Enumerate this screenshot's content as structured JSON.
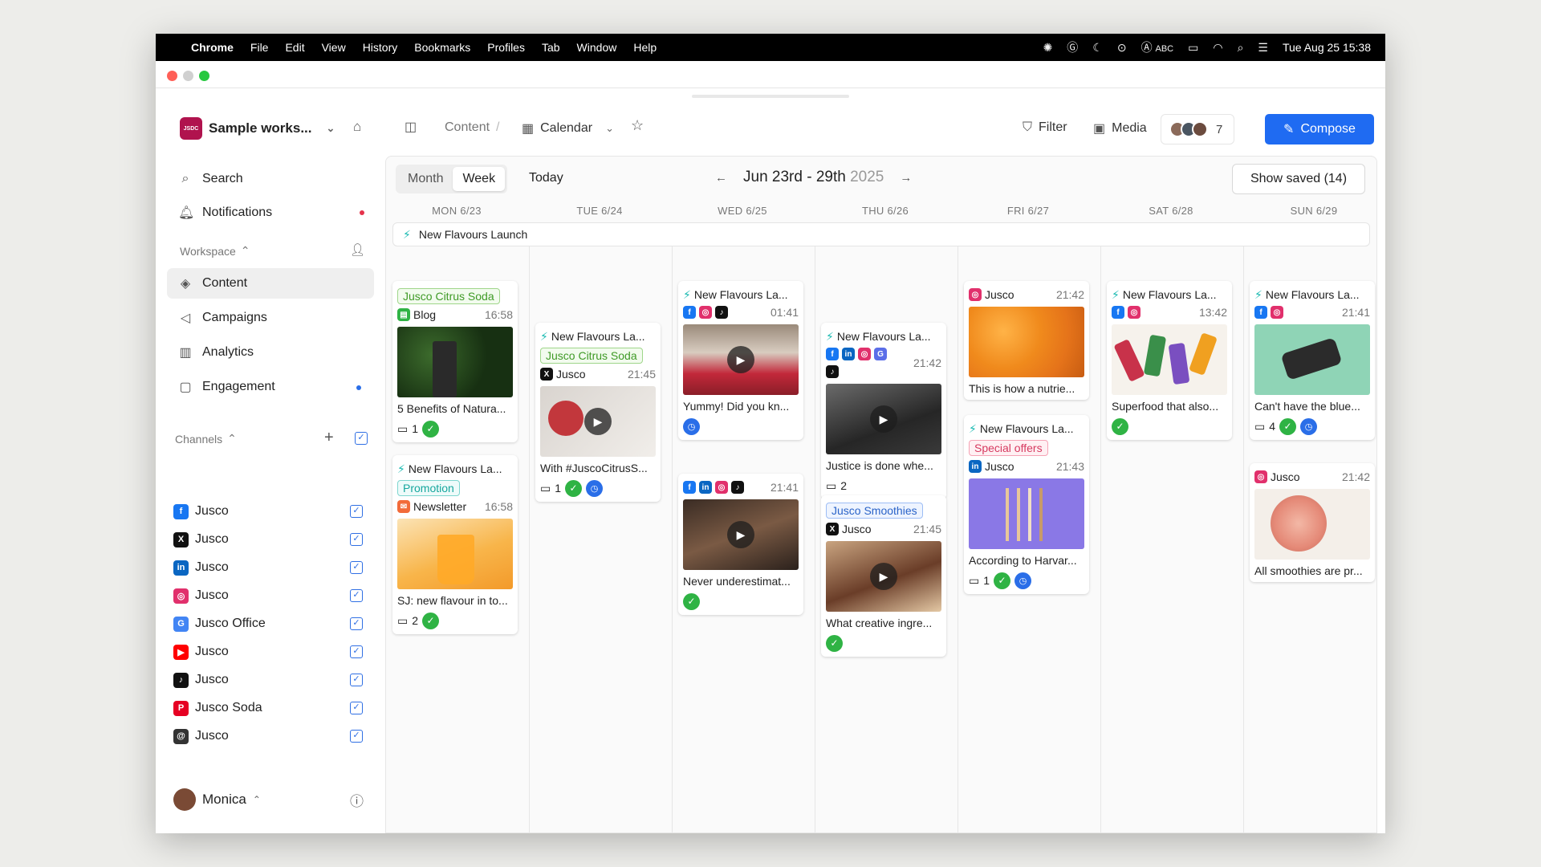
{
  "menubar": {
    "app": "Chrome",
    "items": [
      "File",
      "Edit",
      "View",
      "History",
      "Bookmarks",
      "Profiles",
      "Tab",
      "Window",
      "Help"
    ],
    "input_source": "ABC",
    "clock": "Tue Aug 25  15:38"
  },
  "workspace": {
    "logo": "JSDC",
    "name": "Sample works..."
  },
  "breadcrumb": {
    "content": "Content",
    "separator": "/",
    "calendar": "Calendar"
  },
  "toolbar": {
    "filter": "Filter",
    "media": "Media",
    "members_count": "7",
    "compose": "Compose"
  },
  "sidebar": {
    "search": "Search",
    "notifications": "Notifications",
    "workspace_header": "Workspace",
    "nav": [
      "Content",
      "Campaigns",
      "Analytics",
      "Engagement"
    ],
    "channels_header": "Channels",
    "channels": [
      {
        "name": "Jusco",
        "network": "facebook",
        "color": "#1877f2",
        "glyph": "f"
      },
      {
        "name": "Jusco",
        "network": "x",
        "color": "#111111",
        "glyph": "X"
      },
      {
        "name": "Jusco",
        "network": "linkedin",
        "color": "#0a66c2",
        "glyph": "in"
      },
      {
        "name": "Jusco",
        "network": "instagram",
        "color": "#e1306c",
        "glyph": "◎"
      },
      {
        "name": "Jusco Office",
        "network": "google",
        "color": "#4285f4",
        "glyph": "G"
      },
      {
        "name": "Jusco",
        "network": "youtube",
        "color": "#ff0000",
        "glyph": "▶"
      },
      {
        "name": "Jusco",
        "network": "tiktok",
        "color": "#111111",
        "glyph": "♪"
      },
      {
        "name": "Jusco Soda",
        "network": "pinterest",
        "color": "#e60023",
        "glyph": "P"
      },
      {
        "name": "Jusco",
        "network": "threads",
        "color": "#333333",
        "glyph": "@"
      }
    ],
    "user": "Monica"
  },
  "calendar": {
    "views": [
      "Month",
      "Week"
    ],
    "active_view": "Week",
    "today": "Today",
    "range": "Jun 23rd - 29th",
    "year": "2025",
    "show_saved": "Show saved (14)",
    "days": [
      "MON 6/23",
      "TUE 6/24",
      "WED 6/25",
      "THU 6/26",
      "FRI 6/27",
      "SAT 6/28",
      "SUN 6/29"
    ],
    "campaign": "New Flavours Launch"
  },
  "cards": {
    "mon1": {
      "tag": "Jusco Citrus Soda",
      "channel": "Blog",
      "time": "16:58",
      "caption": "5 Benefits of Natura...",
      "comments": "1"
    },
    "mon2": {
      "campaign": "New Flavours La...",
      "tag": "Promotion",
      "channel": "Newsletter",
      "time": "16:58",
      "caption": "SJ: new flavour in to...",
      "comments": "2"
    },
    "tue1": {
      "campaign": "New Flavours La...",
      "tag": "Jusco Citrus Soda",
      "channel": "Jusco",
      "time": "21:45",
      "caption": "With #JuscoCitrusS...",
      "comments": "1"
    },
    "wed1": {
      "campaign": "New Flavours La...",
      "time": "01:41",
      "caption": "Yummy! Did you kn..."
    },
    "wed2": {
      "time": "21:41",
      "caption": "Never underestimat..."
    },
    "thu1": {
      "campaign": "New Flavours La...",
      "time": "21:42",
      "caption": "Justice is done whe...",
      "comments": "2"
    },
    "thu2": {
      "tag": "Jusco Smoothies",
      "channel": "Jusco",
      "time": "21:45",
      "caption": "What creative ingre..."
    },
    "fri1": {
      "channel": "Jusco",
      "time": "21:42",
      "caption": "This is how a nutrie..."
    },
    "fri2": {
      "campaign": "New Flavours La...",
      "tag": "Special offers",
      "channel": "Jusco",
      "time": "21:43",
      "caption": "According to Harvar...",
      "comments": "1"
    },
    "sat1": {
      "campaign": "New Flavours La...",
      "time": "13:42",
      "caption": "Superfood that also..."
    },
    "sun1": {
      "campaign": "New Flavours La...",
      "time": "21:41",
      "caption": "Can't have the blue...",
      "comments": "4"
    },
    "sun2": {
      "channel": "Jusco",
      "time": "21:42",
      "caption": "All smoothies are pr..."
    }
  },
  "colors": {
    "accent": "#1f6bf2",
    "campaign": "#16b9b0",
    "approved": "#2fb344",
    "scheduled": "#2a6ee8"
  }
}
